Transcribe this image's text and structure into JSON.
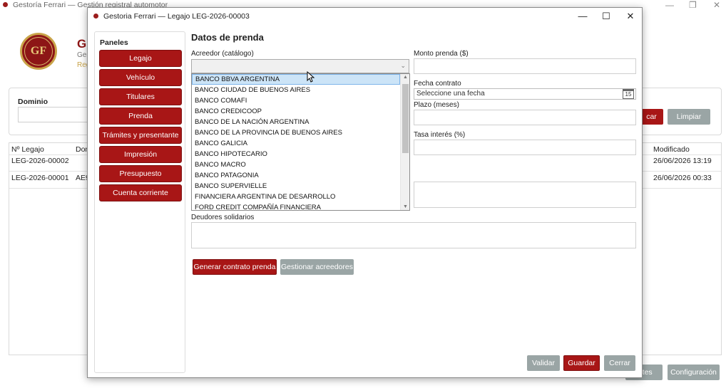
{
  "background": {
    "title": "Gestoría Ferrari — Gestión registral automotor",
    "logo_text": "GF",
    "brand_initial": "G",
    "subtitle1": "Ges",
    "subtitle2": "Reg",
    "filter": {
      "dominio_label": "Dominio",
      "buscar_label": "car",
      "limpiar_label": "Limpiar"
    },
    "grid": {
      "columns": {
        "legajo": "Nº Legajo",
        "dominio": "Dom",
        "modificado": "Modificado"
      },
      "rows": [
        {
          "legajo": "LEG-2026-00002",
          "dominio": "",
          "modificado": "26/06/2026 13:19"
        },
        {
          "legajo": "LEG-2026-00001",
          "dominio": "AE9",
          "modificado": "26/06/2026 00:33"
        }
      ]
    },
    "bottom_buttons": {
      "reportes": "ortes",
      "configuracion": "Configuración"
    }
  },
  "dialog": {
    "title": "Gestoria Ferrari — Legajo LEG-2026-00003",
    "panels_title": "Paneles",
    "panels": [
      "Legajo",
      "Vehículo",
      "Titulares",
      "Prenda",
      "Trámites y presentante",
      "Impresión",
      "Presupuesto",
      "Cuenta corriente"
    ],
    "section_title": "Datos de prenda",
    "acreedor_label": "Acreedor (catálogo)",
    "acreedor_options": [
      "BANCO BBVA ARGENTINA",
      "BANCO CIUDAD DE BUENOS AIRES",
      "BANCO COMAFI",
      "BANCO CREDICOOP",
      "BANCO DE LA NACIÓN ARGENTINA",
      "BANCO DE LA PROVINCIA DE BUENOS AIRES",
      "BANCO GALICIA",
      "BANCO HIPOTECARIO",
      "BANCO MACRO",
      "BANCO PATAGONIA",
      "BANCO SUPERVIELLE",
      "FINANCIERA ARGENTINA DE DESARROLLO",
      "FORD CREDIT COMPAÑÍA FINANCIERA"
    ],
    "monto_label": "Monto prenda ($)",
    "fecha_label": "Fecha contrato",
    "fecha_placeholder": "Seleccione una fecha",
    "calendar_day": "15",
    "plazo_label": "Plazo (meses)",
    "tasa_label": "Tasa interés (%)",
    "deudores_label": "Deudores solidarios",
    "generar_label": "Generar contrato prenda",
    "gestionar_label": "Gestionar acreedores",
    "validar_label": "Validar",
    "guardar_label": "Guardar",
    "cerrar_label": "Cerrar"
  }
}
